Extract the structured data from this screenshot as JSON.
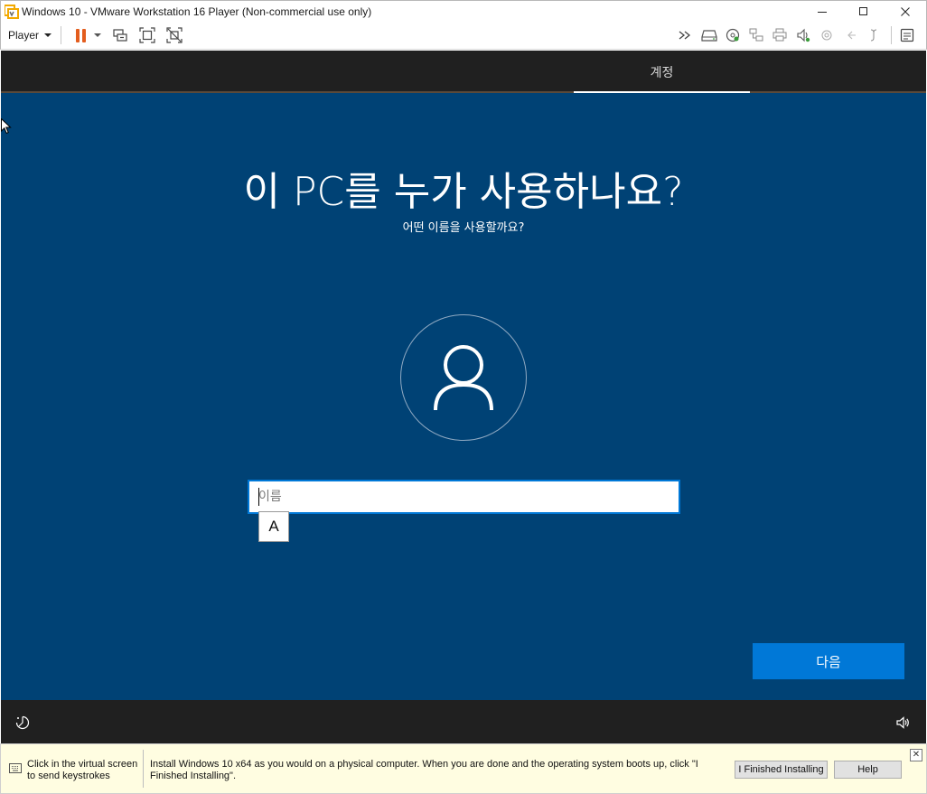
{
  "window": {
    "title": "Windows 10 - VMware Workstation 16 Player (Non-commercial use only)",
    "minimize_glyph": "—",
    "maximize_glyph": "☐",
    "close_glyph": "✕"
  },
  "toolbar": {
    "player_label": "Player",
    "right_icons": [
      "fast-forward-icon",
      "hard-disk-icon",
      "cd-dvd-icon",
      "network-icon",
      "printer-icon",
      "sound-icon",
      "usb-icon",
      "display-icon",
      "serial-icon",
      "messages-icon"
    ]
  },
  "oobe": {
    "tab_account": "계정",
    "heading": "이 PC를 누가 사용하나요?",
    "subheading": "어떤 이름을 사용할까요?",
    "name_placeholder": "이름",
    "name_value": "",
    "ime_mode": "A",
    "next_label": "다음"
  },
  "hint_bar": {
    "click_text": "Click in the virtual screen to send keystrokes",
    "install_text": "Install Windows 10 x64 as you would on a physical computer. When you are done and the operating system boots up, click \"I Finished Installing\".",
    "finished_label": "I Finished Installing",
    "help_label": "Help",
    "close_glyph": "✕"
  },
  "colors": {
    "oobe_background": "#004275",
    "accent": "#0078d7",
    "bar_dark": "#202020",
    "pause_orange": "#e35d1e",
    "hint_background": "#fffde1"
  }
}
